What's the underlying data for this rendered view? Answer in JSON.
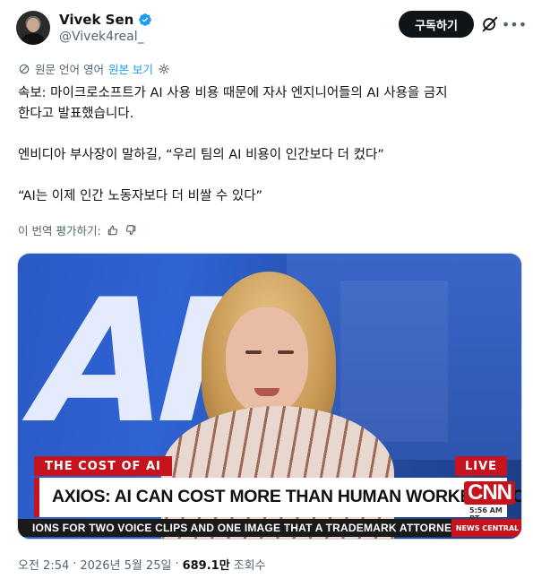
{
  "author": {
    "name": "Vivek Sen",
    "handle": "@Vivek4real_",
    "subscribe_label": "구독하기"
  },
  "translation": {
    "info": "원문 언어 영어",
    "show_original": "원본 보기"
  },
  "tweet": {
    "lines": [
      "속보: 마이크로소프트가 AI 사용 비용 때문에 자사 엔지니어들의 AI 사용을 금지",
      "한다고 발표했습니다.",
      "엔비디아 부사장이 말하길, “우리 팀의 AI 비용이 인간보다 더 컸다”",
      "“AI는 이제 인간 노동자보다 더 비쌀 수 있다”"
    ]
  },
  "rate_translation": "이 번역 평가하기:",
  "media": {
    "background_text": "AI",
    "topic": "THE COST OF AI",
    "live": "LIVE",
    "headline": "AXIOS: AI CAN COST MORE THAN HUMAN WORKERS NOW",
    "network": "CNN",
    "time": "5:56 AM PT",
    "ticker": "IONS FOR TWO VOICE CLIPS AND ONE IMAGE THAT A TRADEMARK ATTORNEY SAYS AF",
    "ticker_brand": "NEWS CENTRAL"
  },
  "footer": {
    "time": "오전 2:54",
    "separator": "·",
    "date": "2026년 5월 25일",
    "views": "689.1만",
    "views_label": "조회수"
  },
  "colors": {
    "accent": "#1d9bf0",
    "text": "#0f1419",
    "muted": "#536471",
    "cnn_red": "#c5141d"
  },
  "icons": [
    "verified-badge-icon",
    "grok-icon",
    "more-icon",
    "globe-icon",
    "gear-icon",
    "thumbs-up-icon",
    "thumbs-down-icon"
  ]
}
